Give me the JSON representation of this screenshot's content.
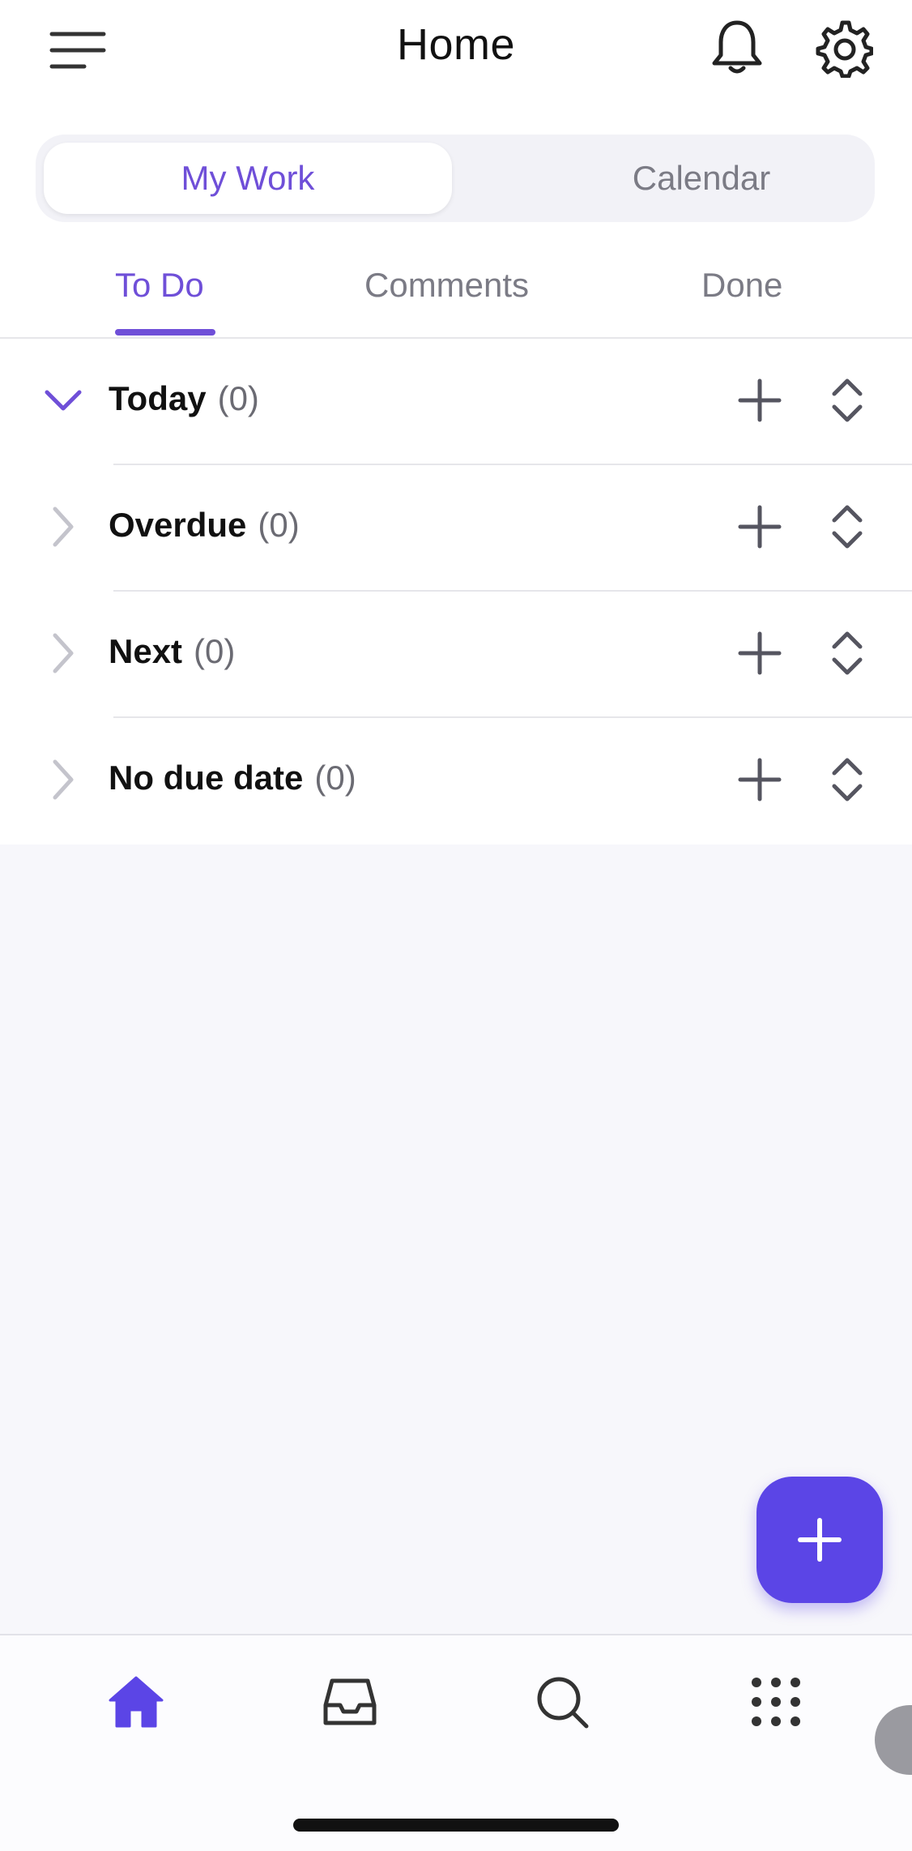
{
  "header": {
    "title": "Home",
    "icons": {
      "menu": "menu-icon",
      "notifications": "bell-icon",
      "settings": "gear-icon"
    }
  },
  "view_switcher": {
    "tabs": [
      {
        "label": "My Work",
        "selected": true
      },
      {
        "label": "Calendar",
        "selected": false
      }
    ]
  },
  "subtabs": [
    {
      "label": "To Do",
      "selected": true
    },
    {
      "label": "Comments",
      "selected": false
    },
    {
      "label": "Done",
      "selected": false
    }
  ],
  "sections": [
    {
      "title": "Today",
      "count": "(0)",
      "expanded": true
    },
    {
      "title": "Overdue",
      "count": "(0)",
      "expanded": false
    },
    {
      "title": "Next",
      "count": "(0)",
      "expanded": false
    },
    {
      "title": "No due date",
      "count": "(0)",
      "expanded": false
    }
  ],
  "fab": {
    "icon": "plus-icon"
  },
  "bottom_nav": {
    "items": [
      {
        "icon": "home-icon",
        "selected": true
      },
      {
        "icon": "inbox-icon",
        "selected": false
      },
      {
        "icon": "search-icon",
        "selected": false
      },
      {
        "icon": "apps-grid-icon",
        "selected": false
      }
    ]
  },
  "colors": {
    "accent": "#6f4fd8",
    "fab": "#5b45e6",
    "text_primary": "#111111",
    "text_secondary": "#7b7b85",
    "icon_gray": "#555560",
    "background": "#f7f7fb"
  }
}
